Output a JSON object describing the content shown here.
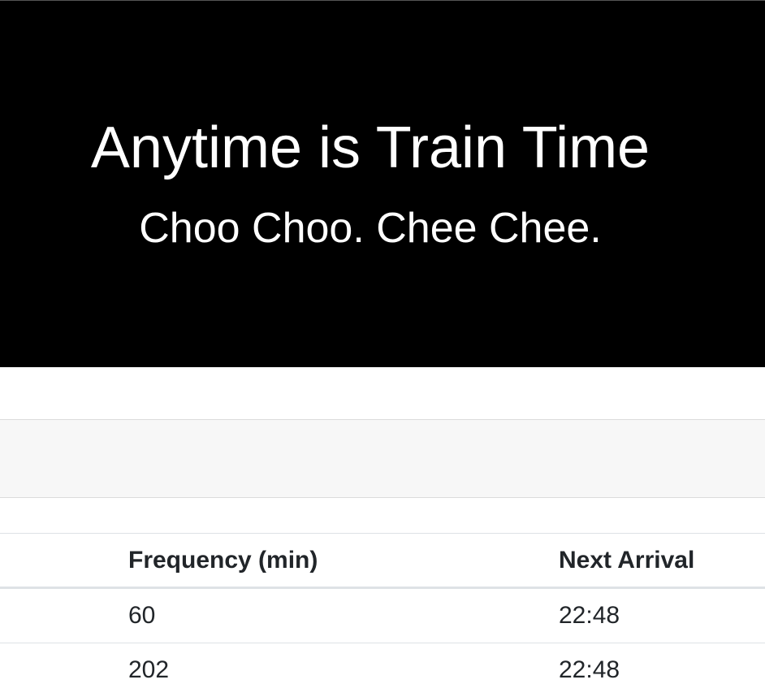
{
  "jumbotron": {
    "title": "Anytime is Train Time",
    "subtitle": "Choo Choo. Chee Chee."
  },
  "table": {
    "columns": [
      "Frequency (min)",
      "Next Arrival"
    ],
    "rows": [
      {
        "frequency": "60",
        "next_arrival": "22:48"
      },
      {
        "frequency": "202",
        "next_arrival": "22:48"
      }
    ]
  },
  "colors": {
    "jumbotron_bg": "#000000",
    "card_header_bg": "#f7f7f7",
    "text": "#212529",
    "border": "#dee2e6"
  }
}
